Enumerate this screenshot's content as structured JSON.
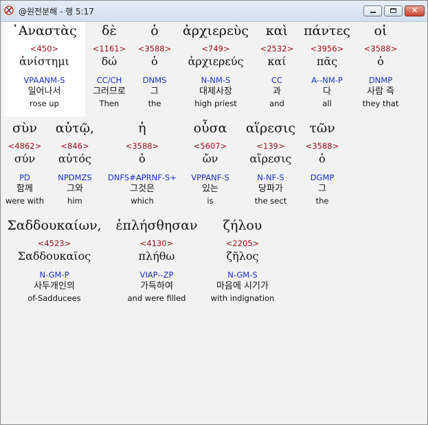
{
  "window": {
    "title": "@원전분해 - 행 5:17"
  },
  "words": [
    {
      "greek": "᾿Αναστὰς",
      "strong": "<450>",
      "lemma": "ἀνίστημι",
      "parse": "VPAANM-S",
      "korean": "일어나서",
      "english": "rose up"
    },
    {
      "greek": "δὲ",
      "strong": "<1161>",
      "lemma": "δώ",
      "parse": "CC/CH",
      "korean": "그러므로",
      "english": "Then"
    },
    {
      "greek": "ὁ",
      "strong": "<3588>",
      "lemma": "ὁ",
      "parse": "DNMS",
      "korean": "그",
      "english": "the"
    },
    {
      "greek": "ἀρχιερεὺς",
      "strong": "<749>",
      "lemma": "ἀρχιερεύς",
      "parse": "N-NM-S",
      "korean": "대제사장",
      "english": "high priest"
    },
    {
      "greek": "καὶ",
      "strong": "<2532>",
      "lemma": "καί",
      "parse": "CC",
      "korean": "과",
      "english": "and"
    },
    {
      "greek": "πάντες",
      "strong": "<3956>",
      "lemma": "πᾶς",
      "parse": "A--NM-P",
      "korean": "다",
      "english": "all"
    },
    {
      "greek": "οἱ",
      "strong": "<3588>",
      "lemma": "ὁ",
      "parse": "DNMP",
      "korean": "사람 즉",
      "english": "they that"
    },
    {
      "greek": "σὺν",
      "strong": "<4862>",
      "lemma": "σύν",
      "parse": "PD",
      "korean": "함께",
      "english": "were with"
    },
    {
      "greek": "αὐτῷ,",
      "strong": "<846>",
      "lemma": "αὐτός",
      "parse": "NPDMZS",
      "korean": "그와",
      "english": "him"
    },
    {
      "greek": "ἡ",
      "strong": "<3588>",
      "lemma": "ὁ",
      "parse": "DNFS#APRNF-S+",
      "korean": "그것은",
      "english": "which"
    },
    {
      "greek": "οὖσα",
      "strong": "<5607>",
      "lemma": "ὤν",
      "parse": "VPPANF-S",
      "korean": "있는",
      "english": "is"
    },
    {
      "greek": "αἵρεσις",
      "strong": "<139>",
      "lemma": "αἵρεσις",
      "parse": "N-NF-S",
      "korean": "당파가",
      "english": "the sect"
    },
    {
      "greek": "τῶν",
      "strong": "<3588>",
      "lemma": "ὁ",
      "parse": "DGMP",
      "korean": "그",
      "english": "the"
    },
    {
      "greek": "Σαδδουκαίων,",
      "strong": "<4523>",
      "lemma": "Σαδδουκαῖος",
      "parse": "N-GM-P",
      "korean": "사두개인의",
      "english": "of-Sadducees"
    },
    {
      "greek": "ἐπλήσθησαν",
      "strong": "<4130>",
      "lemma": "πλήθω",
      "parse": "VIAP--ZP",
      "korean": "가득하여",
      "english": "and were filled"
    },
    {
      "greek": "ζήλου",
      "strong": "<2205>",
      "lemma": "ζῆλος",
      "parse": "N-GM-S",
      "korean": "마음에 시기가",
      "english": "with indignation"
    }
  ]
}
